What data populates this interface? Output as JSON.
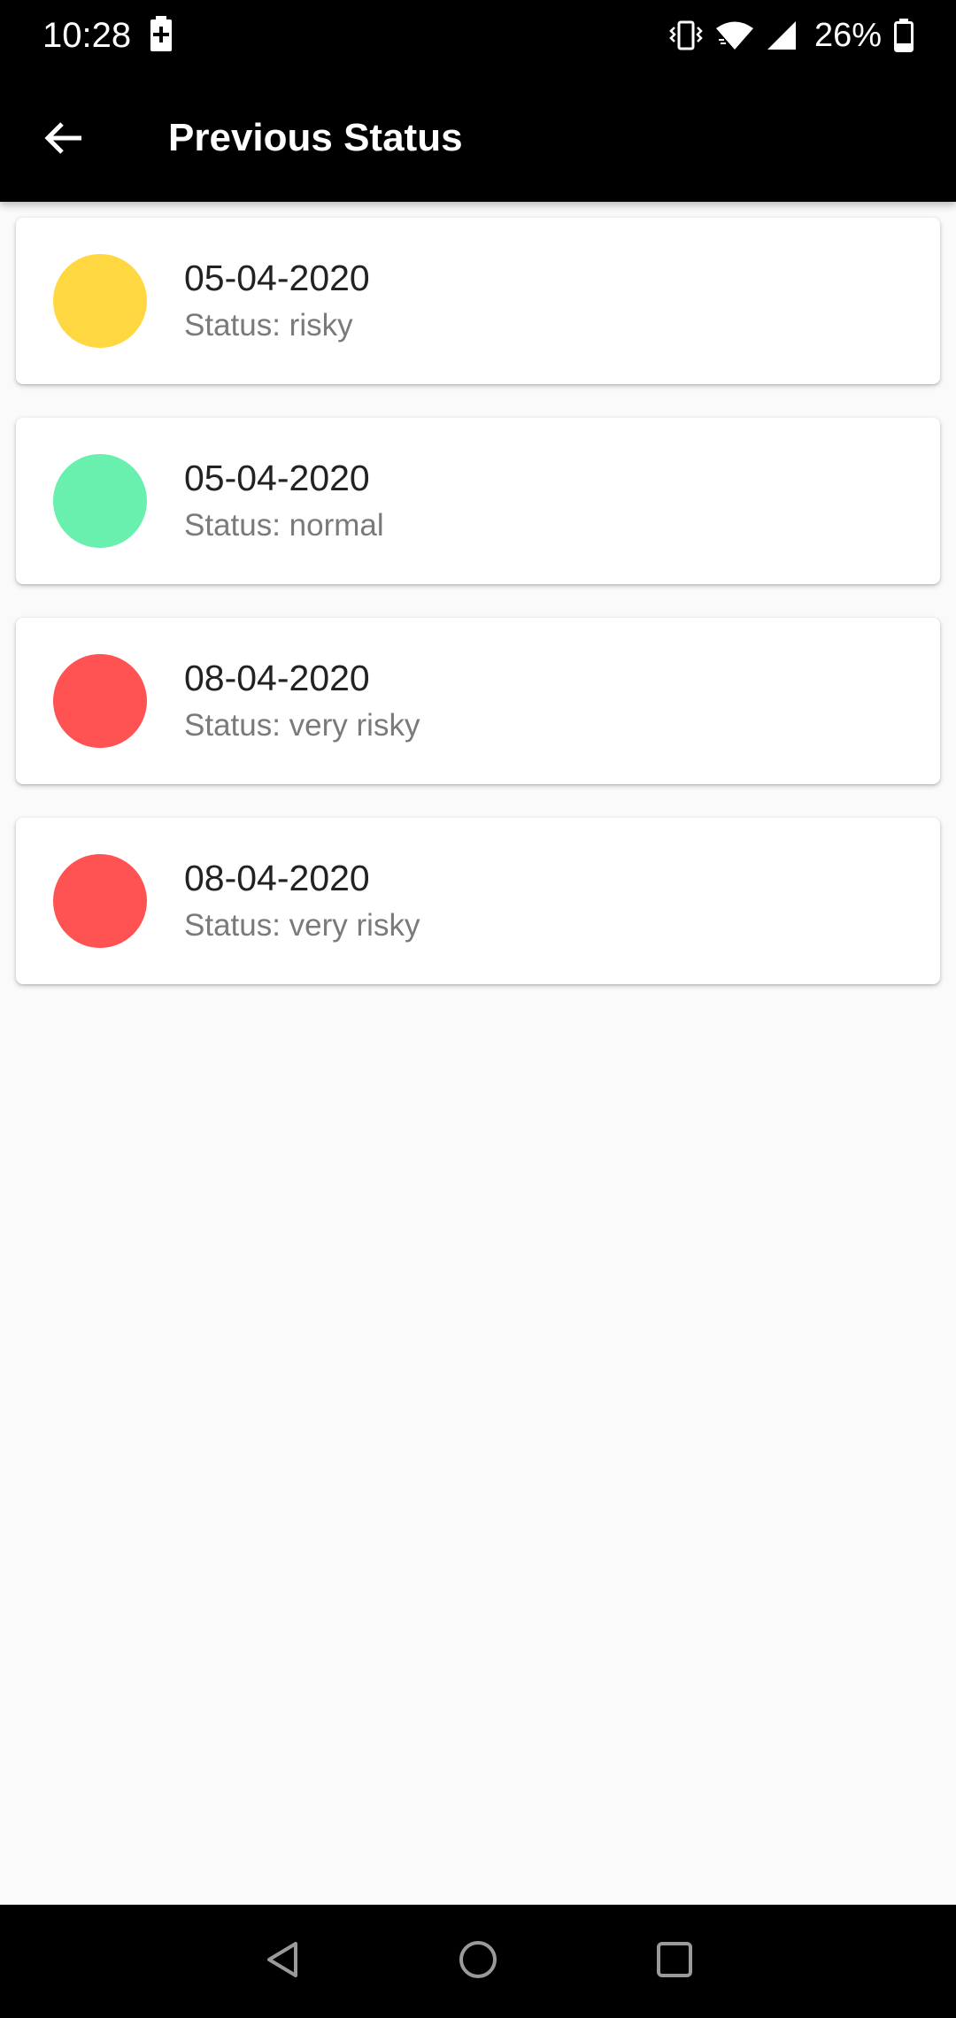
{
  "status_bar": {
    "time": "10:28",
    "battery_percent": "26%",
    "icons": [
      "battery-charging-icon",
      "vibrate-icon",
      "wifi-icon",
      "cell-signal-icon",
      "battery-icon"
    ]
  },
  "app_bar": {
    "title": "Previous Status",
    "back_icon": "arrow-back-icon"
  },
  "colors": {
    "risky": "#FFD740",
    "normal": "#69F0AE",
    "very_risky": "#FF5252",
    "app_bar": "#000000",
    "background": "#FAFAFA"
  },
  "entries": [
    {
      "date": "05-04-2020",
      "status": "Status: risky",
      "color": "#FFD740"
    },
    {
      "date": "05-04-2020",
      "status": "Status: normal",
      "color": "#69F0AE"
    },
    {
      "date": "08-04-2020",
      "status": "Status: very risky",
      "color": "#FF5252"
    },
    {
      "date": "08-04-2020",
      "status": "Status: very risky",
      "color": "#FF5252"
    }
  ],
  "nav_bar": {
    "icons": [
      "back-triangle-icon",
      "home-circle-icon",
      "recents-square-icon"
    ]
  }
}
